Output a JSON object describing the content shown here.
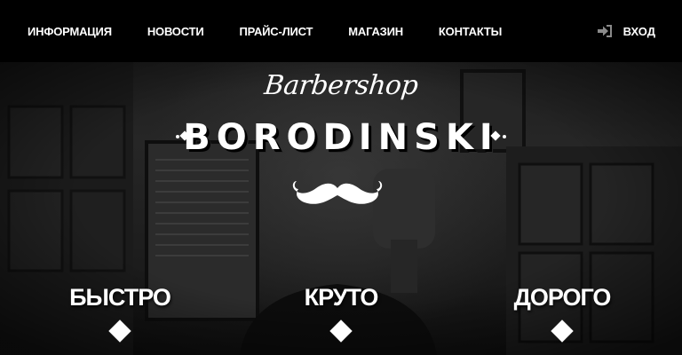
{
  "nav": {
    "items": [
      {
        "label": "ИНФОРМАЦИЯ"
      },
      {
        "label": "НОВОСТИ"
      },
      {
        "label": "ПРАЙС-ЛИСТ"
      },
      {
        "label": "МАГАЗИН"
      },
      {
        "label": "КОНТАКТЫ"
      }
    ],
    "login": {
      "label": "ВХОД",
      "icon": "sign-in-icon"
    }
  },
  "logo": {
    "script": "Barbershop",
    "name": "BORODINSKI",
    "icon": "mustache-icon"
  },
  "features": [
    {
      "label": "БЫСТРО"
    },
    {
      "label": "КРУТО"
    },
    {
      "label": "ДОРОГО"
    }
  ],
  "colors": {
    "nav_background": "#000000",
    "text": "#ffffff",
    "hero_background": "#1e1e1e"
  }
}
